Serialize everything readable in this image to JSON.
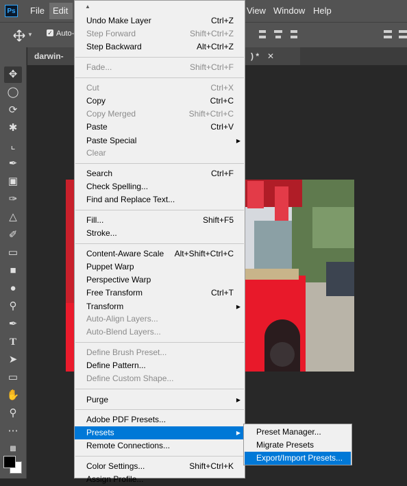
{
  "menubar": {
    "logo": "Ps",
    "items": [
      "File",
      "Edit",
      "View",
      "Window",
      "Help"
    ]
  },
  "options_bar": {
    "auto_label": "Auto-"
  },
  "tabs": [
    {
      "label": "darwin-kor"
    },
    {
      "label": ") *"
    }
  ],
  "edit_menu": {
    "items": [
      {
        "label": "Undo Make Layer",
        "shortcut": "Ctrl+Z",
        "enabled": true
      },
      {
        "label": "Step Forward",
        "shortcut": "Shift+Ctrl+Z",
        "enabled": false
      },
      {
        "label": "Step Backward",
        "shortcut": "Alt+Ctrl+Z",
        "enabled": true
      },
      {
        "label": "Fade...",
        "shortcut": "Shift+Ctrl+F",
        "enabled": false
      },
      {
        "label": "Cut",
        "shortcut": "Ctrl+X",
        "enabled": false
      },
      {
        "label": "Copy",
        "shortcut": "Ctrl+C",
        "enabled": true
      },
      {
        "label": "Copy Merged",
        "shortcut": "Shift+Ctrl+C",
        "enabled": false
      },
      {
        "label": "Paste",
        "shortcut": "Ctrl+V",
        "enabled": true
      },
      {
        "label": "Paste Special",
        "shortcut": "",
        "enabled": true,
        "submenu": true
      },
      {
        "label": "Clear",
        "shortcut": "",
        "enabled": false
      },
      {
        "label": "Search",
        "shortcut": "Ctrl+F",
        "enabled": true
      },
      {
        "label": "Check Spelling...",
        "shortcut": "",
        "enabled": true
      },
      {
        "label": "Find and Replace Text...",
        "shortcut": "",
        "enabled": true
      },
      {
        "label": "Fill...",
        "shortcut": "Shift+F5",
        "enabled": true
      },
      {
        "label": "Stroke...",
        "shortcut": "",
        "enabled": true
      },
      {
        "label": "Content-Aware Scale",
        "shortcut": "Alt+Shift+Ctrl+C",
        "enabled": true
      },
      {
        "label": "Puppet Warp",
        "shortcut": "",
        "enabled": true
      },
      {
        "label": "Perspective Warp",
        "shortcut": "",
        "enabled": true
      },
      {
        "label": "Free Transform",
        "shortcut": "Ctrl+T",
        "enabled": true
      },
      {
        "label": "Transform",
        "shortcut": "",
        "enabled": true,
        "submenu": true
      },
      {
        "label": "Auto-Align Layers...",
        "shortcut": "",
        "enabled": false
      },
      {
        "label": "Auto-Blend Layers...",
        "shortcut": "",
        "enabled": false
      },
      {
        "label": "Define Brush Preset...",
        "shortcut": "",
        "enabled": false
      },
      {
        "label": "Define Pattern...",
        "shortcut": "",
        "enabled": true
      },
      {
        "label": "Define Custom Shape...",
        "shortcut": "",
        "enabled": false
      },
      {
        "label": "Purge",
        "shortcut": "",
        "enabled": true,
        "submenu": true
      },
      {
        "label": "Adobe PDF Presets...",
        "shortcut": "",
        "enabled": true
      },
      {
        "label": "Presets",
        "shortcut": "",
        "enabled": true,
        "submenu": true,
        "highlighted": true
      },
      {
        "label": "Remote Connections...",
        "shortcut": "",
        "enabled": true
      },
      {
        "label": "Color Settings...",
        "shortcut": "Shift+Ctrl+K",
        "enabled": true
      },
      {
        "label": "Assign Profile...",
        "shortcut": "",
        "enabled": true
      }
    ]
  },
  "presets_submenu": {
    "items": [
      {
        "label": "Preset Manager..."
      },
      {
        "label": "Migrate Presets"
      },
      {
        "label": "Export/Import Presets...",
        "highlighted": true
      }
    ]
  },
  "tools": [
    "move-tool-icon",
    "marquee-tool-icon",
    "lasso-tool-icon",
    "quick-select-icon",
    "crop-tool-icon",
    "eyedropper-icon",
    "healing-brush-icon",
    "brush-tool-icon",
    "stamp-tool-icon",
    "history-brush-icon",
    "eraser-icon",
    "gradient-icon",
    "blur-icon",
    "dodge-icon",
    "pen-tool-icon",
    "type-tool-icon",
    "path-select-icon",
    "rectangle-tool-icon",
    "hand-tool-icon",
    "zoom-tool-icon",
    "more-tools-icon"
  ],
  "colors": {
    "highlight": "#0078d7",
    "menu_bg": "#f0f0f0",
    "ui_bg": "#535353"
  }
}
